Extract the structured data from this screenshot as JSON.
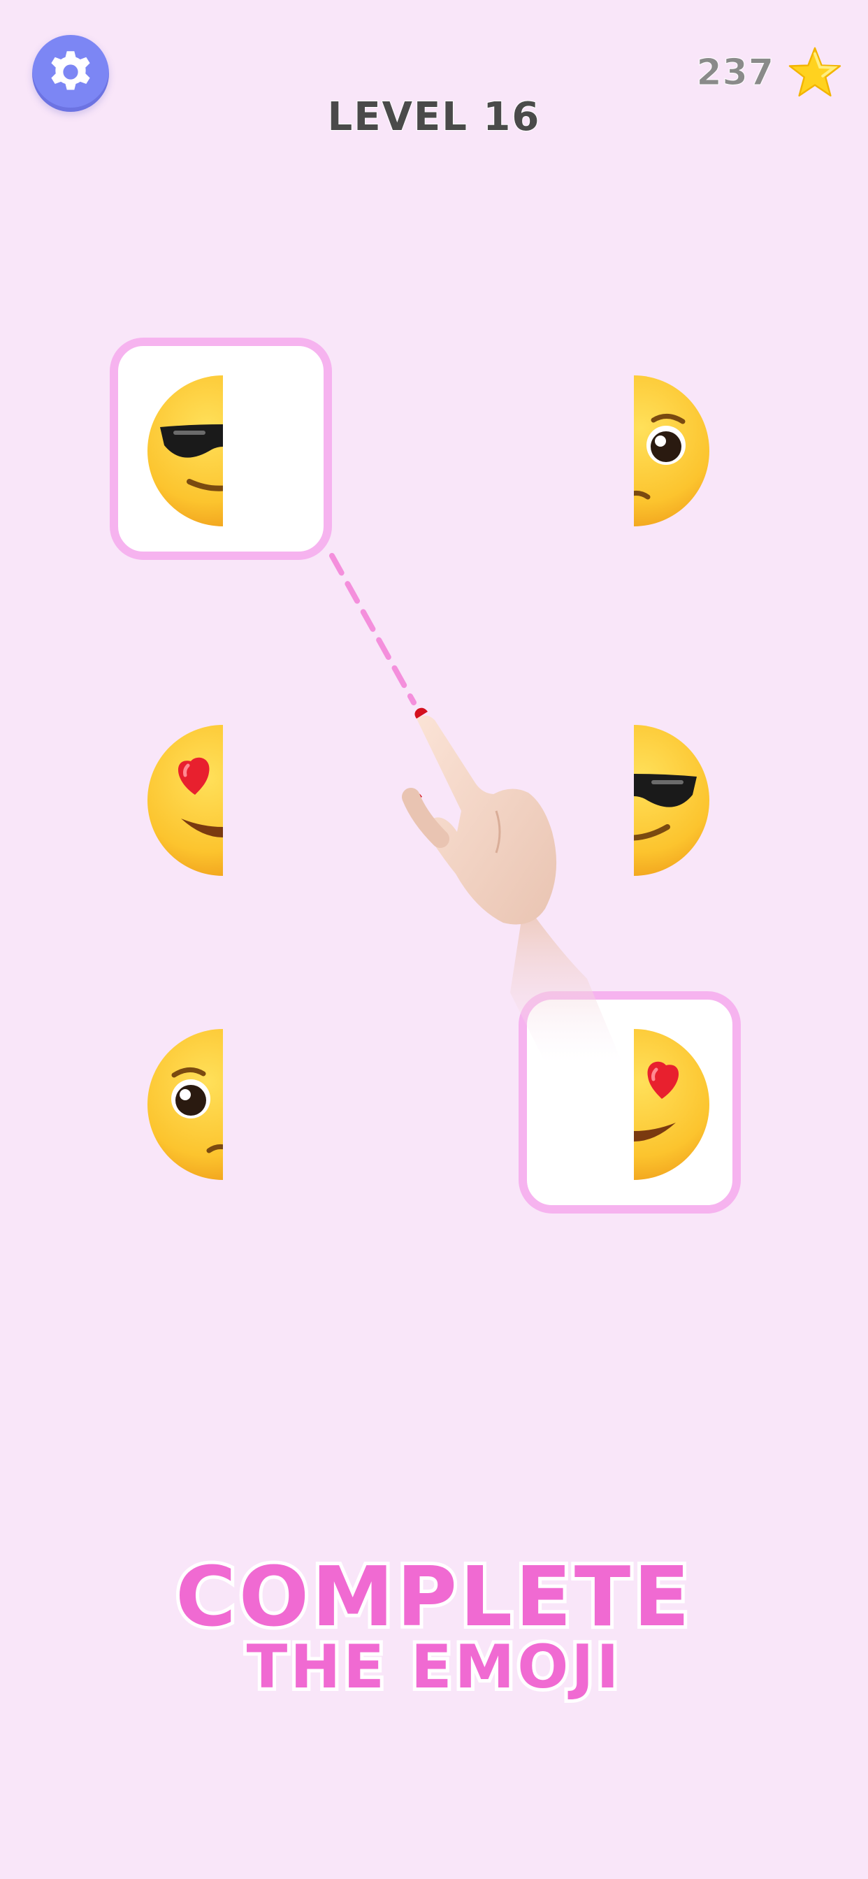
{
  "header": {
    "level_title": "LEVEL 16",
    "score": "237",
    "settings_icon": "gear-icon",
    "score_icon": "star-icon"
  },
  "board": {
    "tiles": [
      {
        "row": 1,
        "column": "left",
        "emoji": "smiling-face-with-sunglasses",
        "half_shown": "left",
        "selected": true
      },
      {
        "row": 1,
        "column": "right",
        "emoji": "pleading-face",
        "half_shown": "right",
        "selected": false
      },
      {
        "row": 2,
        "column": "left",
        "emoji": "smiling-face-with-heart-eyes",
        "half_shown": "left",
        "selected": false
      },
      {
        "row": 2,
        "column": "right",
        "emoji": "smiling-face-with-sunglasses",
        "half_shown": "right",
        "selected": false
      },
      {
        "row": 3,
        "column": "left",
        "emoji": "pleading-face",
        "half_shown": "left",
        "selected": false
      },
      {
        "row": 3,
        "column": "right",
        "emoji": "smiling-face-with-heart-eyes",
        "half_shown": "right",
        "selected": true
      }
    ],
    "tutorial_hint": "hand-pointer-icon"
  },
  "footer": {
    "headline_line1": "COMPLETE",
    "headline_line2": "THE EMOJI"
  },
  "colors": {
    "background": "#f9e6f9",
    "tile_border": "#f6b3ef",
    "settings_button": "#7c86f4",
    "headline": "#f06ad2",
    "emoji_face": "#fcc42e"
  }
}
